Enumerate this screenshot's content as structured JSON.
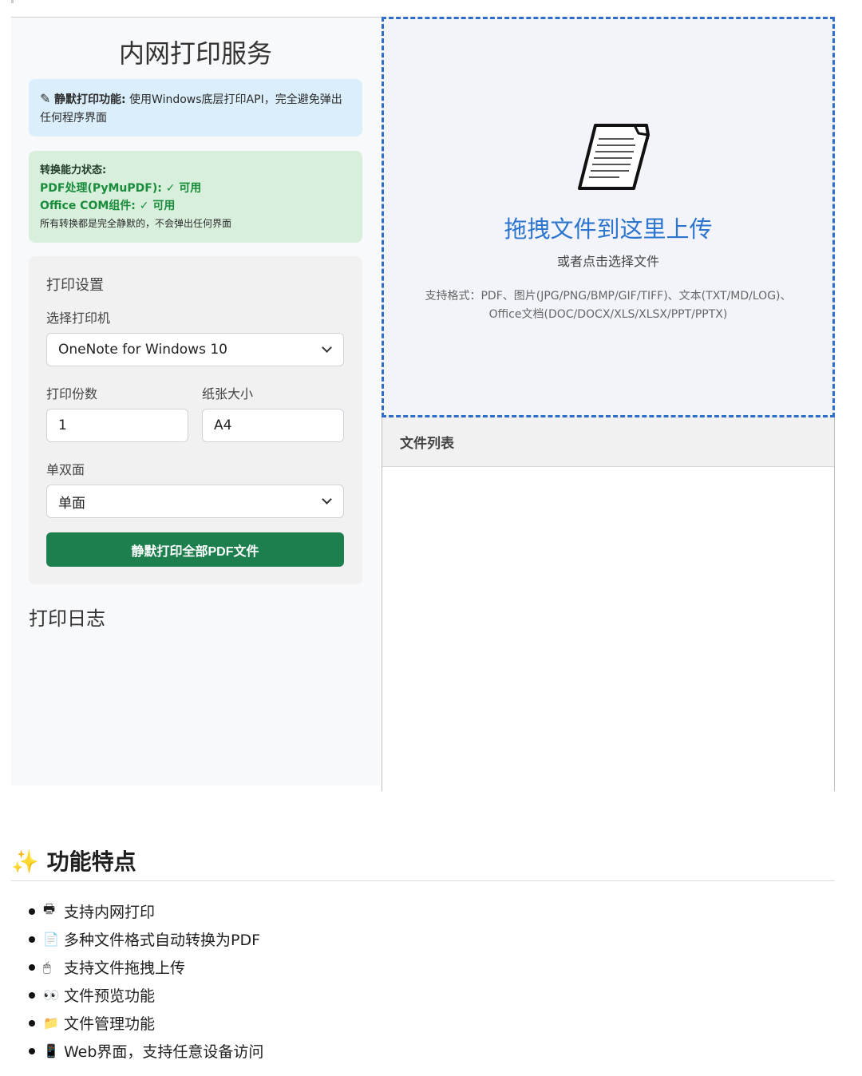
{
  "left": {
    "title": "内网打印服务",
    "info": {
      "bold_label": "静默打印功能:",
      "text": " 使用Windows底层打印API，完全避免弹出任何程序界面"
    },
    "status": {
      "title": "转换能力状态:",
      "pdf": "PDF处理(PyMuPDF): ✓ 可用",
      "office": "Office COM组件: ✓ 可用",
      "note": "所有转换都是完全静默的，不会弹出任何界面"
    },
    "settings": {
      "heading": "打印设置",
      "printer_label": "选择打印机",
      "printer_value": "OneNote for Windows 10",
      "copies_label": "打印份数",
      "copies_value": "1",
      "paper_label": "纸张大小",
      "paper_value": "A4",
      "duplex_label": "单双面",
      "duplex_value": "单面",
      "print_button": "静默打印全部PDF文件"
    },
    "log_title": "打印日志"
  },
  "drop": {
    "title": "拖拽文件到这里上传",
    "subtitle": "或者点击选择文件",
    "formats_line1": "支持格式：PDF、图片(JPG/PNG/BMP/GIF/TIFF)、文本(TXT/MD/LOG)、",
    "formats_line2": "Office文档(DOC/DOCX/XLS/XLSX/PPT/PPTX)"
  },
  "file_list": {
    "title": "文件列表"
  },
  "features": {
    "icon": "sparkles-icon",
    "title": "功能特点",
    "items": [
      {
        "icon": "printer-icon",
        "glyph": "🖶",
        "text": "支持内网打印"
      },
      {
        "icon": "page-icon",
        "glyph": "📄",
        "text": "多种文件格式自动转换为PDF"
      },
      {
        "icon": "mouse-icon",
        "glyph": "🖱",
        "text": "支持文件拖拽上传"
      },
      {
        "icon": "eyes-icon",
        "glyph": "👀",
        "text": "文件预览功能"
      },
      {
        "icon": "folder-icon",
        "glyph": "📁",
        "text": "文件管理功能"
      },
      {
        "icon": "mobile-icon",
        "glyph": "📱",
        "text": "Web界面，支持任意设备访问"
      }
    ]
  }
}
